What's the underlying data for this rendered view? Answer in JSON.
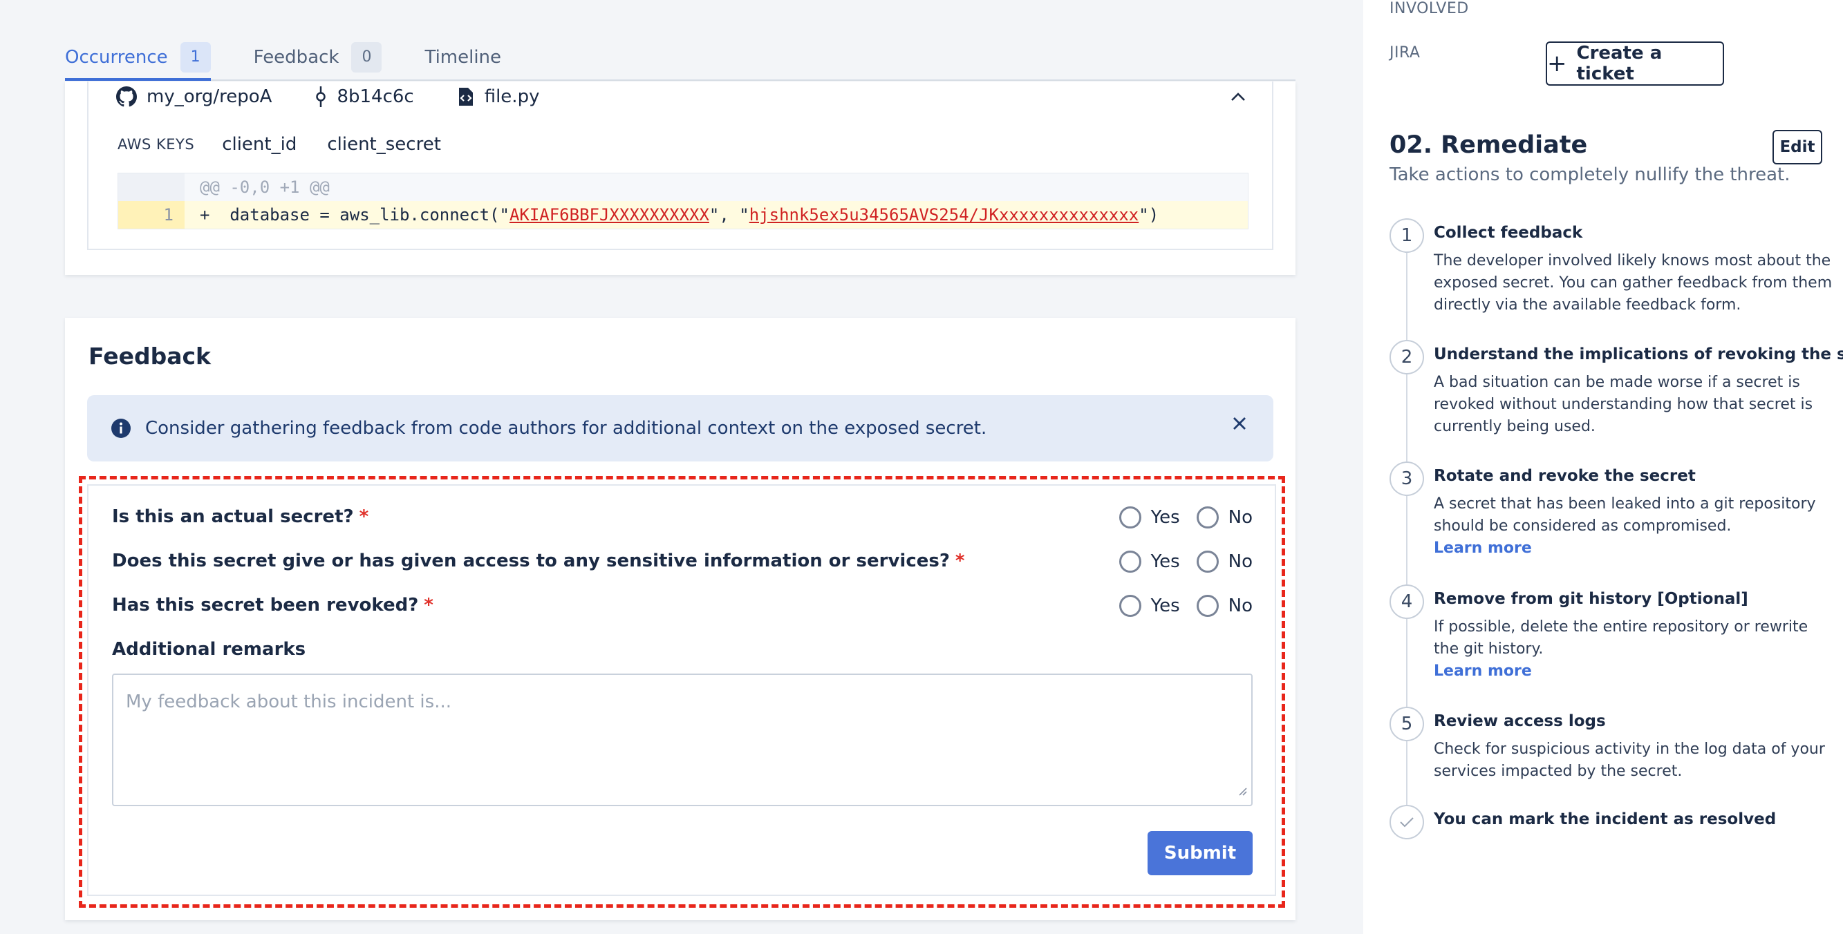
{
  "tabs": [
    {
      "label": "Occurrence",
      "count": "1"
    },
    {
      "label": "Feedback",
      "count": "0"
    },
    {
      "label": "Timeline"
    }
  ],
  "occurrence": {
    "repo": "my_org/repoA",
    "commit": "8b14c6c",
    "file": "file.py",
    "keys_label": "AWS KEYS",
    "keys": [
      "client_id",
      "client_secret"
    ],
    "hunk": "@@ -0,0 +1 @@",
    "line_number": "1",
    "code_prefix": "+  database = aws_lib.connect(\"",
    "secret_1": "AKIAF6BBFJXXXXXXXXXX",
    "code_mid": "\", \"",
    "secret_2": "hjshnk5ex5u34565AVS254/JKxxxxxxxxxxxxxx",
    "code_suffix": "\")"
  },
  "feedback": {
    "title": "Feedback",
    "alert": "Consider gathering feedback from code authors for additional context on the exposed secret.",
    "questions": [
      "Is this an actual secret?",
      "Does this secret give or has given access to any sensitive information or services?",
      "Has this secret been revoked?"
    ],
    "required_mark": "*",
    "yes_label": "Yes",
    "no_label": "No",
    "remarks_label": "Additional remarks",
    "remarks_placeholder": "My feedback about this incident is...",
    "submit_label": "Submit"
  },
  "sidebar": {
    "involved_label": "INVOLVED",
    "jira_label": "JIRA",
    "create_ticket_label": "Create a ticket",
    "remediate_title": "02. Remediate",
    "edit_label": "Edit",
    "remediate_subtitle": "Take actions to completely nullify the threat.",
    "steps": [
      {
        "num": "1",
        "title": "Collect feedback",
        "desc": "The developer involved likely knows most about the exposed secret. You can gather feedback from them directly via the available feedback form."
      },
      {
        "num": "2",
        "title": "Understand the implications of revoking the secret",
        "desc": "A bad situation can be made worse if a secret is revoked without understanding how that secret is currently being used."
      },
      {
        "num": "3",
        "title": "Rotate and revoke the secret",
        "desc": "A secret that has been leaked into a git repository should be considered as compromised.",
        "link": "Learn more"
      },
      {
        "num": "4",
        "title": "Remove from git history [Optional]",
        "desc": "If possible, delete the entire repository or rewrite the git history.",
        "link": "Learn more"
      },
      {
        "num": "5",
        "title": "Review access logs",
        "desc": "Check for suspicious activity in the log data of your services impacted by the secret."
      },
      {
        "title": "You can mark the incident as resolved"
      }
    ]
  }
}
